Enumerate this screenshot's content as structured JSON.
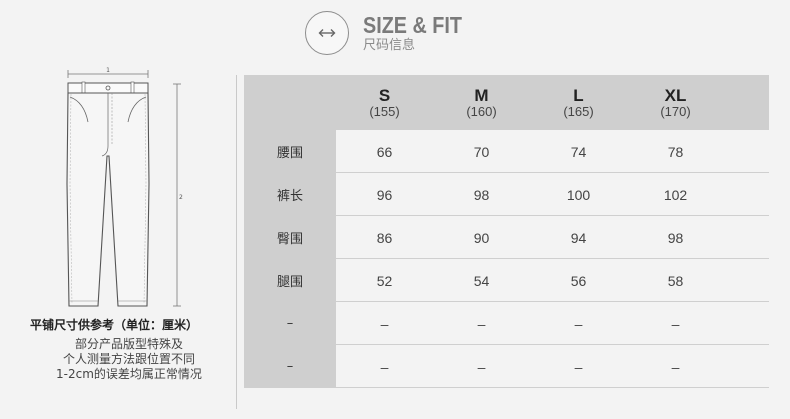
{
  "header": {
    "icon": "resize-horizontal-icon",
    "title": "SIZE & FIT",
    "subtitle": "尺码信息"
  },
  "diagram": {
    "waist_marker": "1",
    "length_marker": "2"
  },
  "notes": {
    "title": "平铺尺寸供参考（单位：厘米）",
    "lines": [
      "部分产品版型特殊及",
      "个人测量方法跟位置不同",
      "1-2cm的误差均属正常情况"
    ]
  },
  "table": {
    "sizes": [
      {
        "size": "S",
        "height": "(155)"
      },
      {
        "size": "M",
        "height": "(160)"
      },
      {
        "size": "L",
        "height": "(165)"
      },
      {
        "size": "XL",
        "height": "(170)"
      }
    ],
    "rows": [
      {
        "label": "腰围",
        "values": [
          "66",
          "70",
          "74",
          "78"
        ]
      },
      {
        "label": "裤长",
        "values": [
          "96",
          "98",
          "100",
          "102"
        ]
      },
      {
        "label": "臀围",
        "values": [
          "86",
          "90",
          "94",
          "98"
        ]
      },
      {
        "label": "腿围",
        "values": [
          "52",
          "54",
          "56",
          "58"
        ]
      },
      {
        "label": "–",
        "values": [
          "–",
          "–",
          "–",
          "–"
        ]
      },
      {
        "label": "–",
        "values": [
          "–",
          "–",
          "–",
          "–"
        ]
      }
    ]
  }
}
